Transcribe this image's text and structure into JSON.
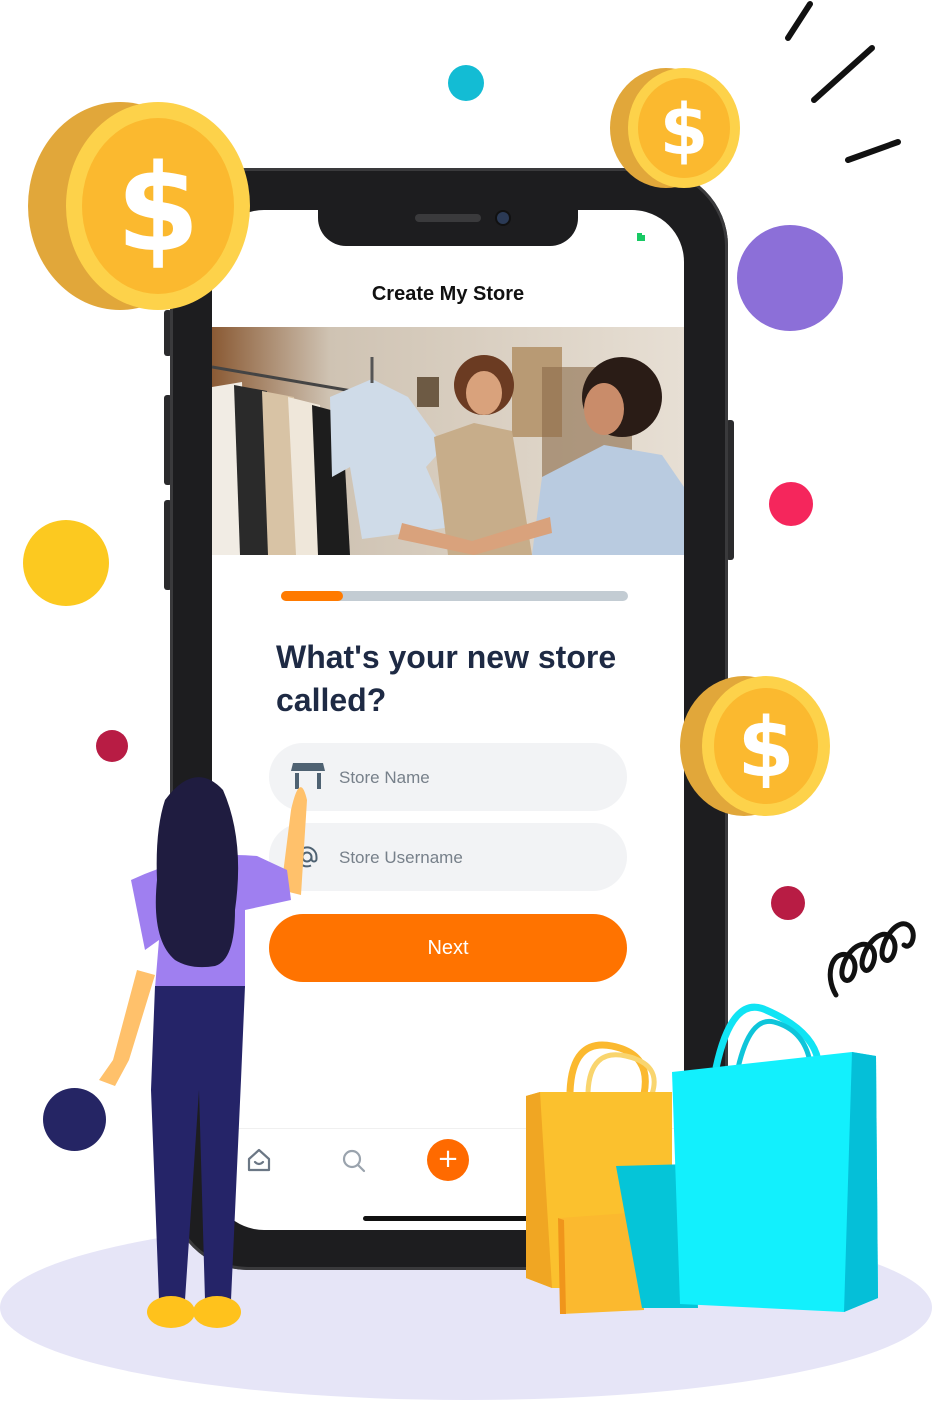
{
  "screen": {
    "title": "Create My Store",
    "progress": 0.18,
    "question": "What's your new store called?",
    "store_name_placeholder": "Store Name",
    "store_username_placeholder": "Store Username",
    "next_label": "Next",
    "plus_label": "+"
  },
  "icons": {
    "store": "store-icon",
    "at": "at-sign-icon",
    "home": "home-icon",
    "search": "search-icon",
    "plus": "plus-icon",
    "coin": "dollar-coin-icon",
    "battery": "battery-icon"
  },
  "colors": {
    "accent": "#ff7300",
    "progress_track": "#c3ccd3",
    "heading": "#1e2a44",
    "field_bg": "#f2f3f5"
  }
}
